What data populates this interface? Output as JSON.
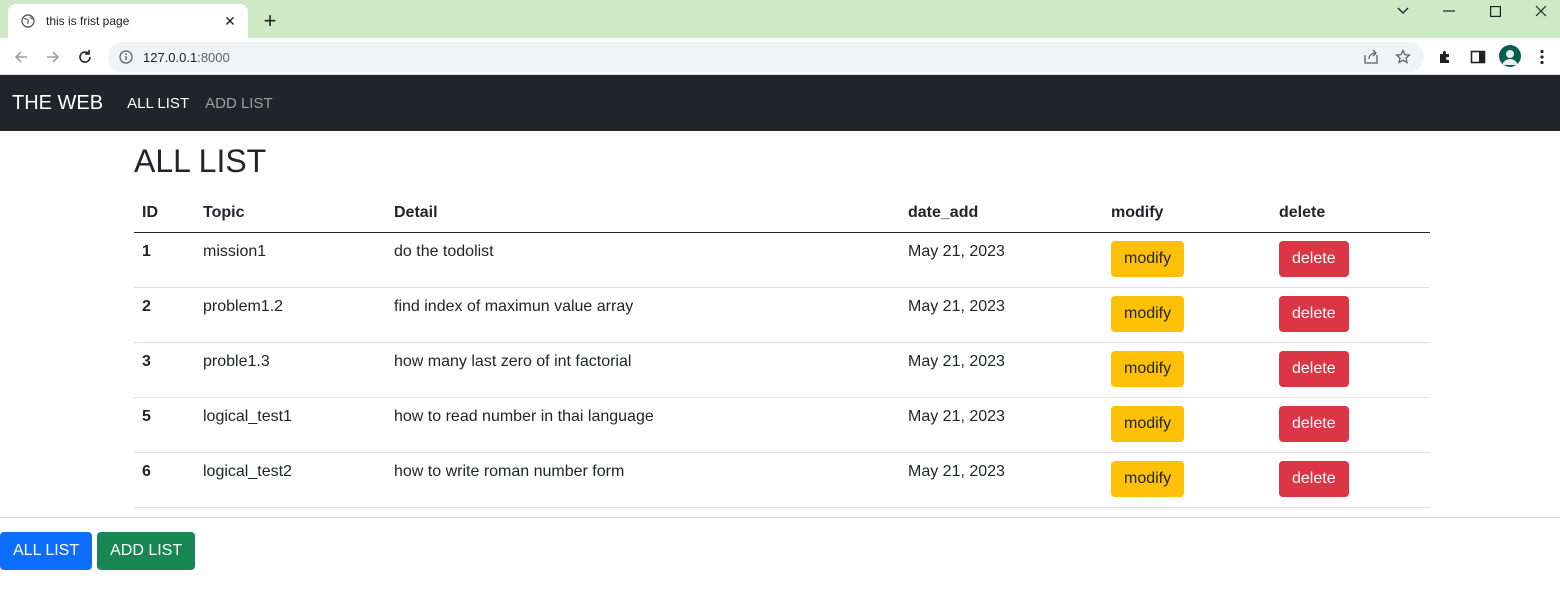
{
  "browser": {
    "tab_title": "this is frist page",
    "url_host": "127.0.0.1",
    "url_port": ":8000"
  },
  "navbar": {
    "brand": "THE WEB",
    "links": [
      {
        "label": "ALL LIST",
        "active": true
      },
      {
        "label": "ADD LIST",
        "active": false
      }
    ]
  },
  "main": {
    "title": "ALL LIST",
    "columns": [
      "ID",
      "Topic",
      "Detail",
      "date_add",
      "modify",
      "delete"
    ],
    "rows": [
      {
        "id": "1",
        "topic": "mission1",
        "detail": "do the todolist",
        "date_add": "May 21, 2023",
        "modify": "modify",
        "delete": "delete"
      },
      {
        "id": "2",
        "topic": "problem1.2",
        "detail": "find index of maximun value array",
        "date_add": "May 21, 2023",
        "modify": "modify",
        "delete": "delete"
      },
      {
        "id": "3",
        "topic": "proble1.3",
        "detail": "how many last zero of int factorial",
        "date_add": "May 21, 2023",
        "modify": "modify",
        "delete": "delete"
      },
      {
        "id": "5",
        "topic": "logical_test1",
        "detail": "how to read number in thai language",
        "date_add": "May 21, 2023",
        "modify": "modify",
        "delete": "delete"
      },
      {
        "id": "6",
        "topic": "logical_test2",
        "detail": "how to write roman number form",
        "date_add": "May 21, 2023",
        "modify": "modify",
        "delete": "delete"
      }
    ]
  },
  "footer": {
    "all_list": "ALL LIST",
    "add_list": "ADD LIST"
  },
  "colors": {
    "tabstrip": "#cdeac5",
    "navbar": "#212529",
    "modify": "#ffc107",
    "delete": "#dc3545",
    "primary": "#0d6efd",
    "success": "#198754"
  }
}
